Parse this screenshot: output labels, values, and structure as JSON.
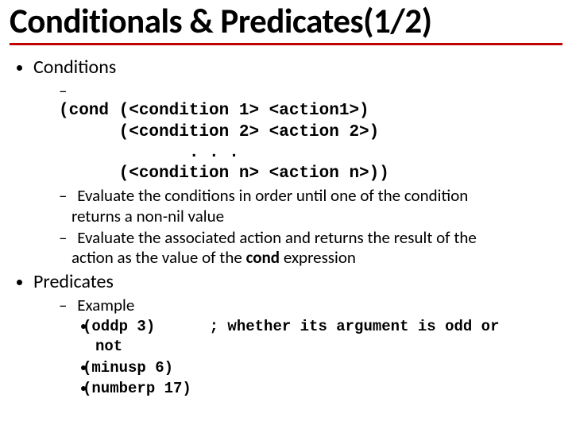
{
  "title": "Conditionals &  Predicates(1/2)",
  "b1": {
    "head": "Conditions",
    "code1": "(cond (<condition 1> <action1>)",
    "code2": "      (<condition 2> <action 2>)",
    "code3": "             . . .",
    "code4": "      (<condition n> <action n>))",
    "rule1a": "Evaluate the conditions in order until one of the condition ",
    "rule1b": "returns a non-nil value",
    "rule2a": "Evaluate the associated action and returns the result of the ",
    "rule2b": "action as the value of the ",
    "rule2bold": "cond",
    "rule2c": " expression"
  },
  "b2": {
    "head": "Predicates",
    "exhead": "Example",
    "ex1": "(oddp 3)      ; whether its argument is odd or\nnot",
    "ex2": "(minusp 6)",
    "ex3": "(numberp 17)"
  }
}
